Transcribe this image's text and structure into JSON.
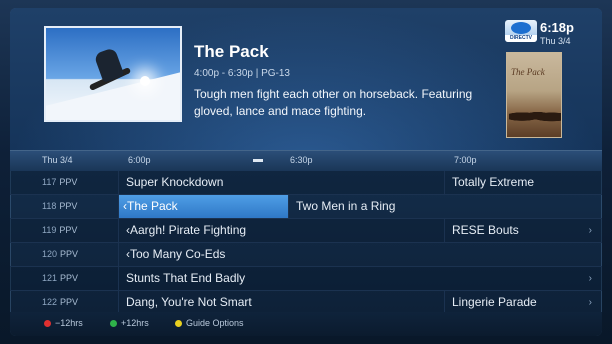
{
  "program": {
    "title": "The Pack",
    "meta": "4:00p - 6:30p | PG-13",
    "description": "Tough men fight each other on horseback. Featuring gloved, lance and mace fighting.",
    "poster_title": "The Pack"
  },
  "status": {
    "logo_text": "DIRECTV",
    "time": "6:18p",
    "date": "Thu 3/4"
  },
  "guide": {
    "header": {
      "date": "Thu 3/4",
      "times": [
        "6:00p",
        "6:30p",
        "7:00p"
      ]
    },
    "rows": [
      {
        "channel": "117",
        "tag": "PPV",
        "programs": [
          "Super Knockdown",
          "Totally Extreme"
        ],
        "selected": -1
      },
      {
        "channel": "118",
        "tag": "PPV",
        "programs": [
          "‹The Pack",
          "Two Men in a Ring"
        ],
        "selected": 0
      },
      {
        "channel": "119",
        "tag": "PPV",
        "programs": [
          "‹Aargh! Pirate Fighting",
          "RESE Bouts"
        ],
        "selected": -1
      },
      {
        "channel": "120",
        "tag": "PPV",
        "programs": [
          "‹Too Many Co-Eds"
        ],
        "selected": -1
      },
      {
        "channel": "121",
        "tag": "PPV",
        "programs": [
          "Stunts That End Badly"
        ],
        "selected": -1
      },
      {
        "channel": "122",
        "tag": "PPV",
        "programs": [
          "Dang, You're Not Smart",
          "Lingerie Parade"
        ],
        "selected": -1
      }
    ],
    "row_arrow": "›"
  },
  "footer": {
    "keys": [
      {
        "label": "−12hrs",
        "color": "#e03030"
      },
      {
        "label": "+12hrs",
        "color": "#2fb24a"
      },
      {
        "label": "Guide Options",
        "color": "#e8d020"
      }
    ]
  }
}
